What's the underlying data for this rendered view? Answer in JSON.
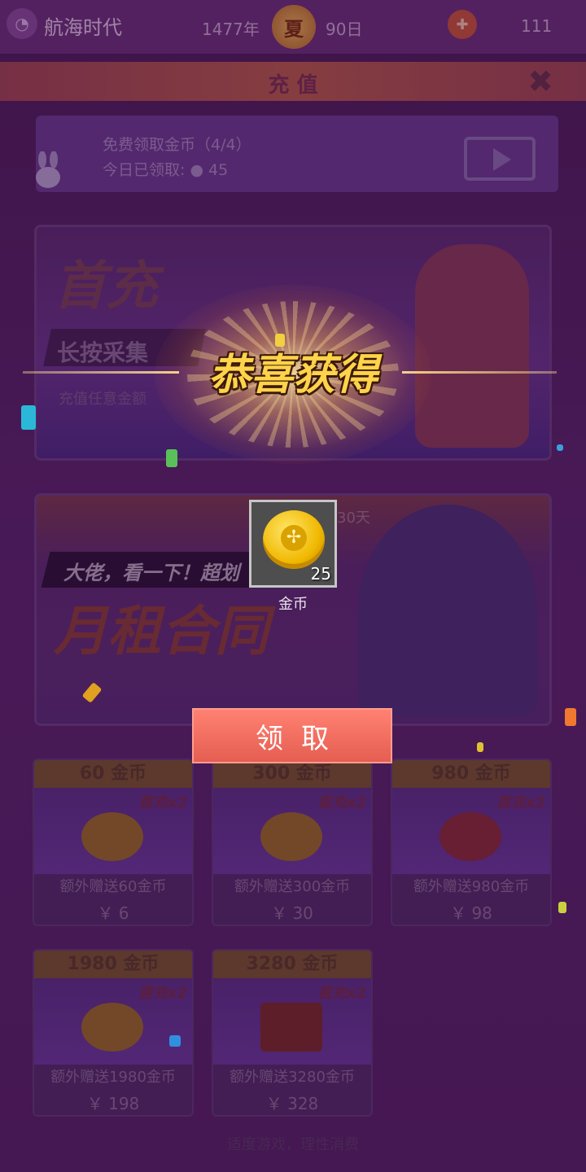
{
  "topbar": {
    "app_name": "航海时代",
    "year": "1477年",
    "season": "夏",
    "day": "90日",
    "count": "111"
  },
  "header": {
    "title": "充 值"
  },
  "free_panel": {
    "line1": "免费领取金币（4/4）",
    "line2": "今日已领取: ● 45"
  },
  "banner1": {
    "title": "首充",
    "tag": "长按采集",
    "subtitle": "充值任意金额"
  },
  "banner2": {
    "tag": "大佬，看一下！超划",
    "title": "月租合同",
    "days": "30天"
  },
  "cards": [
    {
      "name": "60 金币",
      "badge": "首充x2",
      "bonus": "额外赠送60金币",
      "price": "￥ 6"
    },
    {
      "name": "300 金币",
      "badge": "首充x2",
      "bonus": "额外赠送300金币",
      "price": "￥ 30"
    },
    {
      "name": "980 金币",
      "badge": "首充x2",
      "bonus": "额外赠送980金币",
      "price": "￥ 98"
    },
    {
      "name": "1980 金币",
      "badge": "首充x2",
      "bonus": "额外赠送1980金币",
      "price": "￥ 198"
    },
    {
      "name": "3280 金币",
      "badge": "首充x2",
      "bonus": "额外赠送3280金币",
      "price": "￥ 328"
    }
  ],
  "footer": "适度游戏，理性消费",
  "reward_popup": {
    "title": "恭喜获得",
    "item_label": "金币",
    "item_qty": "25",
    "claim_label": "领取"
  },
  "colors": {
    "accent_button": "#e55e52",
    "title_gold": "#ffd34a"
  }
}
